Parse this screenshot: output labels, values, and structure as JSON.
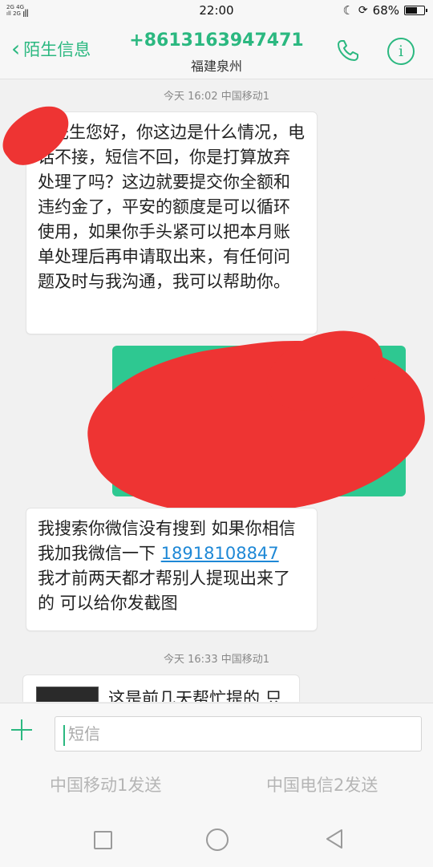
{
  "status_bar": {
    "network_top": "2G",
    "network_mid": "4G",
    "network_bottom": "2G",
    "time": "22:00",
    "battery_text": "68%",
    "battery_level": 0.68
  },
  "header": {
    "back_label": "陌生信息",
    "phone": "+8613163947471",
    "location": "福建泉州"
  },
  "conversation": {
    "timestamp_1": "今天 16:02  中国移动1",
    "message_1": "先生您好，你这边是什么情况，电话不接，短信不回，你是打算放弃处理了吗？这边就要提交你全额和违约金了，平安的额度是可以循环使用，如果你手头紧可以把本月账单处理后再申请取出来，有任何问题及时与我沟通，我可以帮助你。",
    "message_2_part1": "我搜索你微信没有搜到 如果你相信我加我微信一下 ",
    "message_2_link": "18918108847",
    "message_2_part2": "我才前两天都才帮别人提现出来了的 可以给你发截图",
    "timestamp_2": "今天 16:33  中国移动1",
    "message_3_partial": "这是前几天帮忙提的 只"
  },
  "input": {
    "placeholder": "短信",
    "send_sim1": "中国移动1发送",
    "send_sim2": "中国电信2发送"
  },
  "colors": {
    "accent": "#2bb880",
    "outgoing_bubble": "#2ec891",
    "redaction": "#ee3433",
    "link": "#1e88d6"
  }
}
